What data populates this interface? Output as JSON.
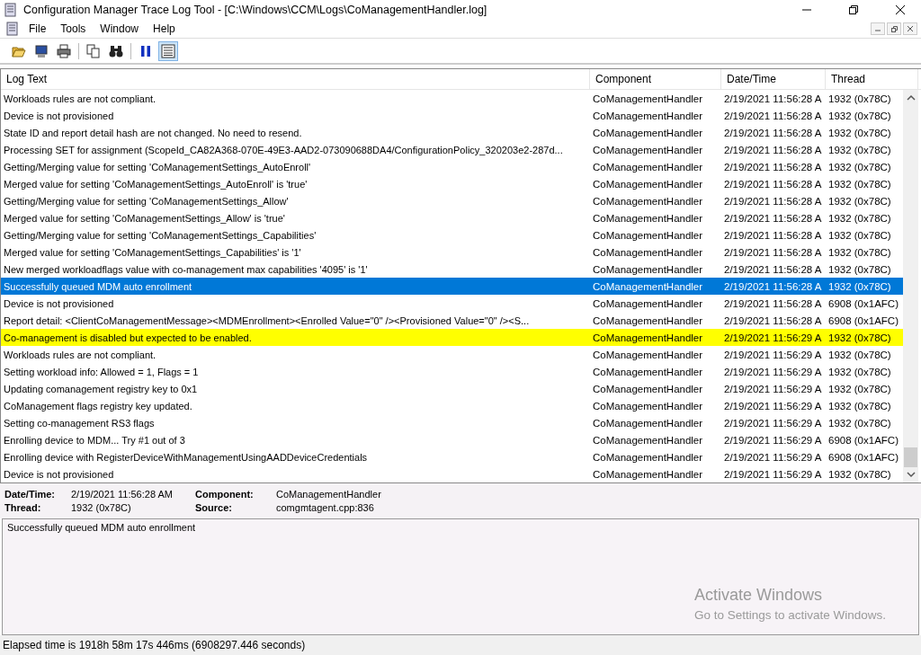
{
  "window": {
    "title": "Configuration Manager Trace Log Tool - [C:\\Windows\\CCM\\Logs\\CoManagementHandler.log]"
  },
  "menu": [
    "File",
    "Tools",
    "Window",
    "Help"
  ],
  "table": {
    "columns": [
      "Log Text",
      "Component",
      "Date/Time",
      "Thread"
    ],
    "rows": [
      {
        "text": "Workloads rules are not compliant.",
        "component": "CoManagementHandler",
        "datetime": "2/19/2021 11:56:28 A",
        "thread": "1932 (0x78C)",
        "selected": false,
        "kind": "normal"
      },
      {
        "text": "Device is not provisioned",
        "component": "CoManagementHandler",
        "datetime": "2/19/2021 11:56:28 A",
        "thread": "1932 (0x78C)",
        "selected": false,
        "kind": "normal"
      },
      {
        "text": "State ID and report detail hash are not changed. No need to resend.",
        "component": "CoManagementHandler",
        "datetime": "2/19/2021 11:56:28 A",
        "thread": "1932 (0x78C)",
        "selected": false,
        "kind": "normal"
      },
      {
        "text": "Processing SET for assignment (ScopeId_CA82A368-070E-49E3-AAD2-073090688DA4/ConfigurationPolicy_320203e2-287d...",
        "component": "CoManagementHandler",
        "datetime": "2/19/2021 11:56:28 A",
        "thread": "1932 (0x78C)",
        "selected": false,
        "kind": "normal"
      },
      {
        "text": "Getting/Merging value for setting 'CoManagementSettings_AutoEnroll'",
        "component": "CoManagementHandler",
        "datetime": "2/19/2021 11:56:28 A",
        "thread": "1932 (0x78C)",
        "selected": false,
        "kind": "normal"
      },
      {
        "text": "Merged value for setting 'CoManagementSettings_AutoEnroll' is 'true'",
        "component": "CoManagementHandler",
        "datetime": "2/19/2021 11:56:28 A",
        "thread": "1932 (0x78C)",
        "selected": false,
        "kind": "normal"
      },
      {
        "text": "Getting/Merging value for setting 'CoManagementSettings_Allow'",
        "component": "CoManagementHandler",
        "datetime": "2/19/2021 11:56:28 A",
        "thread": "1932 (0x78C)",
        "selected": false,
        "kind": "normal"
      },
      {
        "text": "Merged value for setting 'CoManagementSettings_Allow' is 'true'",
        "component": "CoManagementHandler",
        "datetime": "2/19/2021 11:56:28 A",
        "thread": "1932 (0x78C)",
        "selected": false,
        "kind": "normal"
      },
      {
        "text": "Getting/Merging value for setting 'CoManagementSettings_Capabilities'",
        "component": "CoManagementHandler",
        "datetime": "2/19/2021 11:56:28 A",
        "thread": "1932 (0x78C)",
        "selected": false,
        "kind": "normal"
      },
      {
        "text": "Merged value for setting 'CoManagementSettings_Capabilities' is '1'",
        "component": "CoManagementHandler",
        "datetime": "2/19/2021 11:56:28 A",
        "thread": "1932 (0x78C)",
        "selected": false,
        "kind": "normal"
      },
      {
        "text": "New merged workloadflags value with co-management max capabilities '4095' is '1'",
        "component": "CoManagementHandler",
        "datetime": "2/19/2021 11:56:28 A",
        "thread": "1932 (0x78C)",
        "selected": false,
        "kind": "normal"
      },
      {
        "text": "Successfully queued MDM auto enrollment",
        "component": "CoManagementHandler",
        "datetime": "2/19/2021 11:56:28 A",
        "thread": "1932 (0x78C)",
        "selected": true,
        "kind": "normal"
      },
      {
        "text": "Device is not provisioned",
        "component": "CoManagementHandler",
        "datetime": "2/19/2021 11:56:28 A",
        "thread": "6908 (0x1AFC)",
        "selected": false,
        "kind": "normal"
      },
      {
        "text": "Report detail: <ClientCoManagementMessage><MDMEnrollment><Enrolled Value=\"0\" /><Provisioned Value=\"0\" /><S...",
        "component": "CoManagementHandler",
        "datetime": "2/19/2021 11:56:28 A",
        "thread": "6908 (0x1AFC)",
        "selected": false,
        "kind": "normal"
      },
      {
        "text": "Co-management is disabled but expected to be enabled.",
        "component": "CoManagementHandler",
        "datetime": "2/19/2021 11:56:29 A",
        "thread": "1932 (0x78C)",
        "selected": false,
        "kind": "warning"
      },
      {
        "text": "Workloads rules are not compliant.",
        "component": "CoManagementHandler",
        "datetime": "2/19/2021 11:56:29 A",
        "thread": "1932 (0x78C)",
        "selected": false,
        "kind": "normal"
      },
      {
        "text": "Setting workload info: Allowed = 1, Flags = 1",
        "component": "CoManagementHandler",
        "datetime": "2/19/2021 11:56:29 A",
        "thread": "1932 (0x78C)",
        "selected": false,
        "kind": "normal"
      },
      {
        "text": "Updating comanagement registry key to 0x1",
        "component": "CoManagementHandler",
        "datetime": "2/19/2021 11:56:29 A",
        "thread": "1932 (0x78C)",
        "selected": false,
        "kind": "normal"
      },
      {
        "text": "CoManagement flags registry key updated.",
        "component": "CoManagementHandler",
        "datetime": "2/19/2021 11:56:29 A",
        "thread": "1932 (0x78C)",
        "selected": false,
        "kind": "normal"
      },
      {
        "text": "Setting co-management RS3 flags",
        "component": "CoManagementHandler",
        "datetime": "2/19/2021 11:56:29 A",
        "thread": "1932 (0x78C)",
        "selected": false,
        "kind": "normal"
      },
      {
        "text": "Enrolling device to MDM... Try #1 out of 3",
        "component": "CoManagementHandler",
        "datetime": "2/19/2021 11:56:29 A",
        "thread": "6908 (0x1AFC)",
        "selected": false,
        "kind": "normal"
      },
      {
        "text": "Enrolling device with RegisterDeviceWithManagementUsingAADDeviceCredentials",
        "component": "CoManagementHandler",
        "datetime": "2/19/2021 11:56:29 A",
        "thread": "6908 (0x1AFC)",
        "selected": false,
        "kind": "normal"
      },
      {
        "text": "Device is not provisioned",
        "component": "CoManagementHandler",
        "datetime": "2/19/2021 11:56:29 A",
        "thread": "1932 (0x78C)",
        "selected": false,
        "kind": "normal"
      }
    ]
  },
  "details": [
    {
      "label": "Date/Time:",
      "value": "2/19/2021 11:56:28 AM"
    },
    {
      "label": "Component:",
      "value": "CoManagementHandler"
    },
    {
      "label": "Thread:",
      "value": "1932 (0x78C)"
    },
    {
      "label": "Source:",
      "value": "comgmtagent.cpp:836"
    }
  ],
  "message": "Successfully queued MDM auto enrollment",
  "activation": {
    "title": "Activate Windows",
    "subtitle": "Go to Settings to activate Windows."
  },
  "status_bar": "Elapsed time is 1918h 58m 17s 446ms (6908297.446 seconds)"
}
